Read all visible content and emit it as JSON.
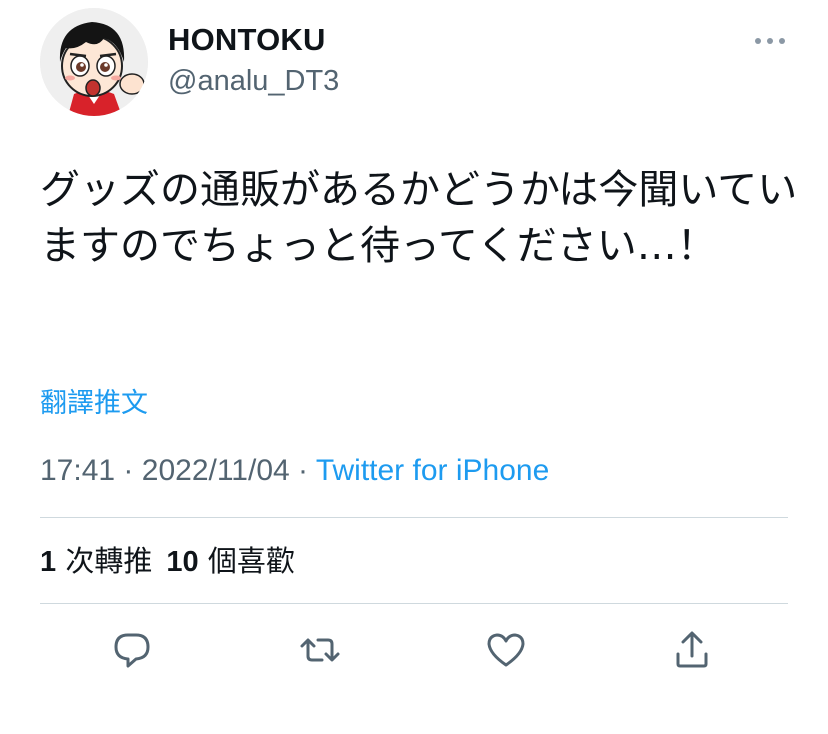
{
  "user": {
    "display_name": "HONTOKU",
    "handle": "@analu_DT3"
  },
  "tweet": {
    "text": "グッズの通販があるかどうかは今聞いていますのでちょっと待ってください…！",
    "translate_label": "翻譯推文",
    "time": "17:41",
    "separator": "·",
    "date": "2022/11/04",
    "source": "Twitter for iPhone"
  },
  "stats": {
    "retweets_count": "1",
    "retweets_label": "次轉推",
    "likes_count": "10",
    "likes_label": "個喜歡"
  },
  "icons": {
    "more": "more-horizontal-icon",
    "reply": "reply-icon",
    "retweet": "retweet-icon",
    "like": "heart-icon",
    "share": "share-icon"
  },
  "colors": {
    "accent": "#1d9bf0",
    "secondary_text": "#536471",
    "primary_text": "#0f1419",
    "divider": "#cfd9de",
    "icon": "#536471"
  }
}
